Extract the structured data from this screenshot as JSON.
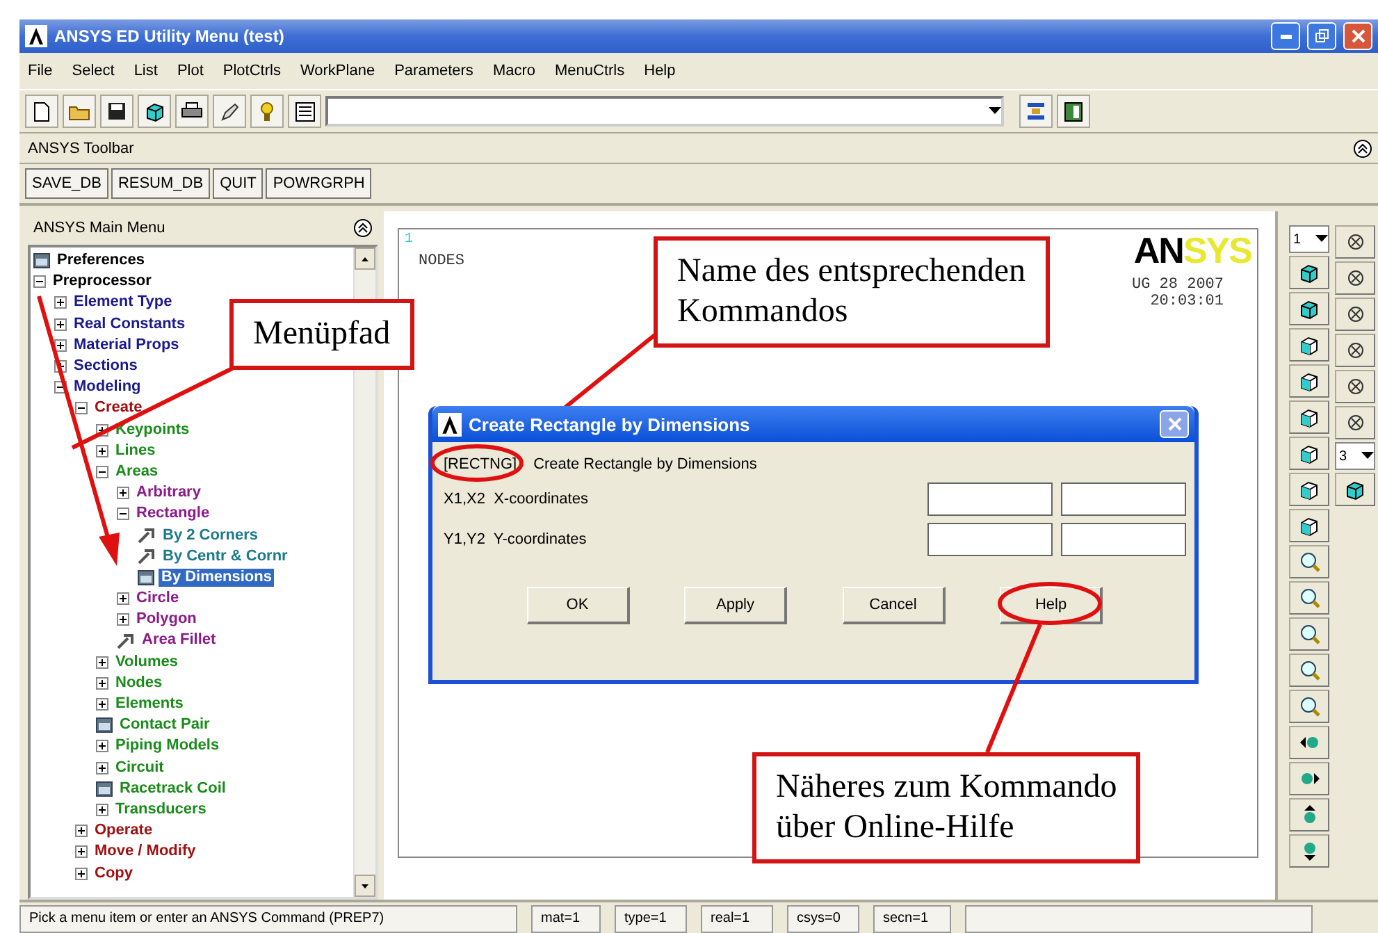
{
  "window": {
    "title": "ANSYS ED Utility Menu (test)"
  },
  "menu_bar": [
    "File",
    "Select",
    "List",
    "Plot",
    "PlotCtrls",
    "WorkPlane",
    "Parameters",
    "Macro",
    "MenuCtrls",
    "Help"
  ],
  "toolbar": {
    "title": "ANSYS Toolbar",
    "buttons": [
      "SAVE_DB",
      "RESUM_DB",
      "QUIT",
      "POWRGRPH"
    ]
  },
  "main_menu": {
    "title": "ANSYS Main Menu",
    "items": [
      {
        "label": "Preferences",
        "kind": "dialog",
        "selected": false
      },
      {
        "label": "Preprocessor",
        "kind": "branch",
        "expanded": true,
        "selected": false,
        "children": [
          {
            "label": "Element Type",
            "kind": "branch",
            "expanded": false,
            "selected": false
          },
          {
            "label": "Real Constants",
            "kind": "branch",
            "expanded": false,
            "selected": false
          },
          {
            "label": "Material Props",
            "kind": "branch",
            "expanded": false,
            "selected": false
          },
          {
            "label": "Sections",
            "kind": "branch",
            "expanded": false,
            "selected": false
          },
          {
            "label": "Modeling",
            "kind": "branch",
            "expanded": true,
            "selected": false,
            "children": [
              {
                "label": "Create",
                "kind": "branch",
                "expanded": true,
                "selected": false,
                "children": [
                  {
                    "label": "Keypoints",
                    "kind": "branch",
                    "expanded": false,
                    "selected": false
                  },
                  {
                    "label": "Lines",
                    "kind": "branch",
                    "expanded": false,
                    "selected": false
                  },
                  {
                    "label": "Areas",
                    "kind": "branch",
                    "expanded": true,
                    "selected": false,
                    "children": [
                      {
                        "label": "Arbitrary",
                        "kind": "branch",
                        "expanded": false,
                        "selected": false
                      },
                      {
                        "label": "Rectangle",
                        "kind": "branch",
                        "expanded": true,
                        "selected": false,
                        "children": [
                          {
                            "label": "By 2 Corners",
                            "kind": "pick",
                            "selected": false
                          },
                          {
                            "label": "By Centr & Cornr",
                            "kind": "pick",
                            "selected": false
                          },
                          {
                            "label": "By Dimensions",
                            "kind": "dialog",
                            "selected": true
                          }
                        ]
                      },
                      {
                        "label": "Circle",
                        "kind": "branch",
                        "expanded": false,
                        "selected": false
                      },
                      {
                        "label": "Polygon",
                        "kind": "branch",
                        "expanded": false,
                        "selected": false
                      },
                      {
                        "label": "Area Fillet",
                        "kind": "pick",
                        "selected": false
                      }
                    ]
                  },
                  {
                    "label": "Volumes",
                    "kind": "branch",
                    "expanded": false,
                    "selected": false
                  },
                  {
                    "label": "Nodes",
                    "kind": "branch",
                    "expanded": false,
                    "selected": false
                  },
                  {
                    "label": "Elements",
                    "kind": "branch",
                    "expanded": false,
                    "selected": false
                  },
                  {
                    "label": "Contact Pair",
                    "kind": "dialog",
                    "selected": false
                  },
                  {
                    "label": "Piping Models",
                    "kind": "branch",
                    "expanded": false,
                    "selected": false
                  },
                  {
                    "label": "Circuit",
                    "kind": "branch",
                    "expanded": false,
                    "selected": false
                  },
                  {
                    "label": "Racetrack Coil",
                    "kind": "dialog",
                    "selected": false
                  },
                  {
                    "label": "Transducers",
                    "kind": "branch",
                    "expanded": false,
                    "selected": false
                  }
                ]
              },
              {
                "label": "Operate",
                "kind": "branch",
                "expanded": false,
                "selected": false
              },
              {
                "label": "Move / Modify",
                "kind": "branch",
                "expanded": false,
                "selected": false
              },
              {
                "label": "Copy",
                "kind": "branch",
                "expanded": false,
                "selected": false
              }
            ]
          }
        ]
      }
    ]
  },
  "graphics": {
    "window_number": "1",
    "label": "NODES",
    "logo_dark": "AN",
    "logo_light": "SYS",
    "date": "UG 28 2007",
    "time": "20:03:01"
  },
  "dialog": {
    "title": "Create Rectangle by Dimensions",
    "command": "[RECTNG]",
    "description": "Create Rectangle by Dimensions",
    "rows": [
      {
        "key": "X1,X2",
        "label": "X-coordinates"
      },
      {
        "key": "Y1,Y2",
        "label": "Y-coordinates"
      }
    ],
    "buttons": [
      "OK",
      "Apply",
      "Cancel",
      "Help"
    ]
  },
  "view_toolbar": {
    "window_select": "1",
    "second_select": "3"
  },
  "annotations": [
    {
      "lines": [
        "Menüpfad"
      ]
    },
    {
      "lines": [
        "Name des entsprechenden",
        "Kommandos"
      ]
    },
    {
      "lines": [
        "Näheres zum Kommando",
        "über Online-Hilfe"
      ]
    }
  ],
  "status_bar": {
    "prompt": "Pick a menu item or enter an ANSYS Command (PREP7)",
    "fields": [
      "mat=1",
      "type=1",
      "real=1",
      "csys=0",
      "secn=1"
    ]
  }
}
